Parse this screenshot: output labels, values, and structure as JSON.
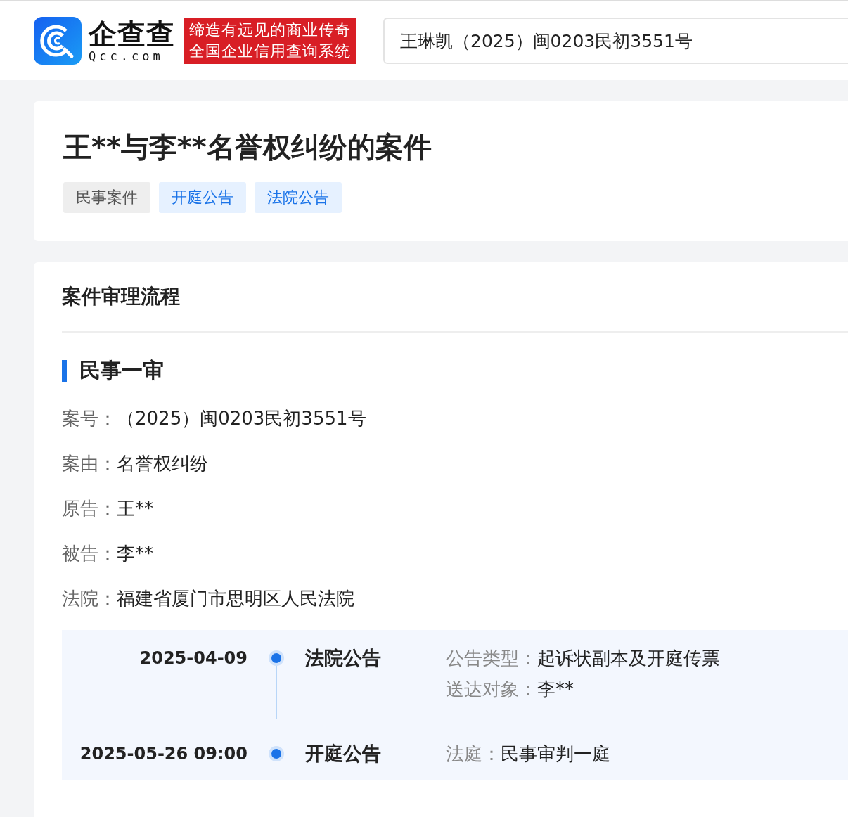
{
  "header": {
    "logo": {
      "name": "企查查",
      "domain": "Qcc.com"
    },
    "slogan": [
      "缔造有远见的商业传奇",
      "全国企业信用查询系统"
    ],
    "search": {
      "value": "王琳凯（2025）闽0203民初3551号"
    }
  },
  "case": {
    "title": "王**与李**名誉权纠纷的案件",
    "tags": [
      {
        "label": "民事案件",
        "kind": "plain"
      },
      {
        "label": "开庭公告",
        "kind": "link"
      },
      {
        "label": "法院公告",
        "kind": "link"
      }
    ]
  },
  "process": {
    "heading": "案件审理流程",
    "stage": "民事一审",
    "fields": [
      {
        "label": "案号：",
        "value": "（2025）闽0203民初3551号"
      },
      {
        "label": "案由：",
        "value": "名誉权纠纷"
      },
      {
        "label": "原告：",
        "value": "王**"
      },
      {
        "label": "被告：",
        "value": "李**"
      },
      {
        "label": "法院：",
        "value": "福建省厦门市思明区人民法院"
      }
    ],
    "timeline": [
      {
        "date": "2025-04-09",
        "title": "法院公告",
        "details": [
          {
            "label": "公告类型：",
            "value": "起诉状副本及开庭传票"
          },
          {
            "label": "送达对象：",
            "value": "李**"
          }
        ]
      },
      {
        "date": "2025-05-26 09:00",
        "title": "开庭公告",
        "details": [
          {
            "label": "法庭：",
            "value": "民事审判一庭"
          }
        ]
      }
    ]
  }
}
